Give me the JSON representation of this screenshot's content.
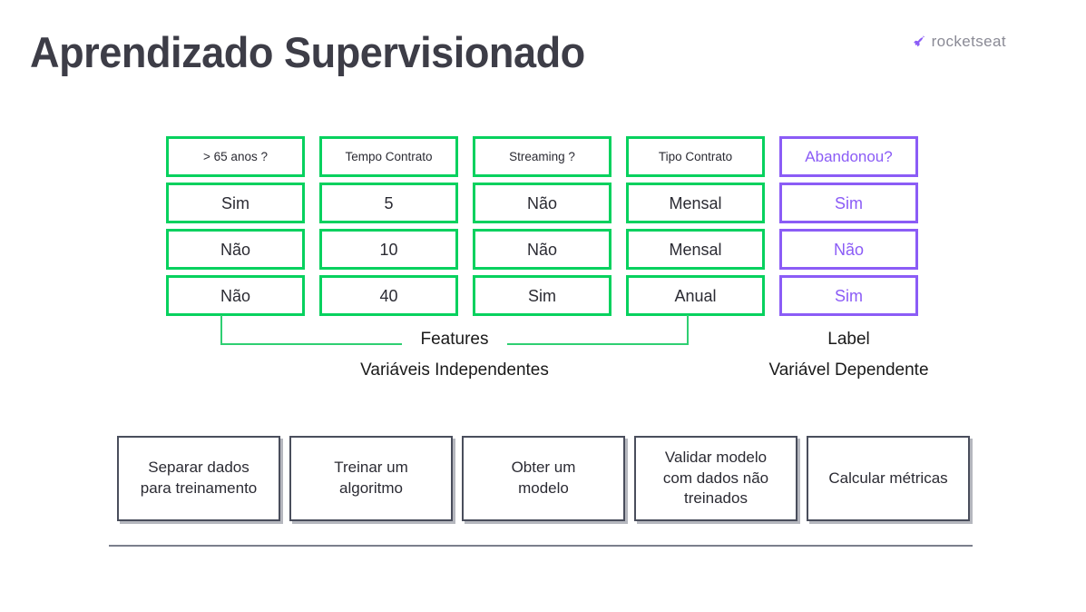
{
  "slide": {
    "title": "Aprendizado Supervisionado",
    "brand": {
      "name": "rocketseat",
      "icon": "rocket-icon",
      "mark_color": "#8b5cf6",
      "text_color": "#8a8a95"
    }
  },
  "colors": {
    "feature_green": "#07d15e",
    "label_purple": "#8b5cf6",
    "text_dark": "#2b2b33",
    "process_border": "#4a4e5c",
    "rule_gray": "#7b7f8c",
    "title_gray": "#3d3d47"
  },
  "table": {
    "headers": [
      "> 65 anos ?",
      "Tempo Contrato",
      "Streaming ?",
      "Tipo Contrato",
      "Abandonou?"
    ],
    "rows": [
      [
        "Sim",
        "5",
        "Não",
        "Mensal",
        "Sim"
      ],
      [
        "Não",
        "10",
        "Não",
        "Mensal",
        "Não"
      ],
      [
        "Não",
        "40",
        "Sim",
        "Anual",
        "Sim"
      ]
    ],
    "label_column_index": 4
  },
  "annotations": {
    "features_title": "Features",
    "features_subtitle": "Variáveis Independentes",
    "label_title": "Label",
    "label_subtitle": "Variável Dependente"
  },
  "process": {
    "steps": [
      "Separar dados\npara treinamento",
      "Treinar um\nalgoritmo",
      "Obter um\nmodelo",
      "Validar modelo\ncom dados não\ntreinados",
      "Calcular métricas"
    ]
  }
}
